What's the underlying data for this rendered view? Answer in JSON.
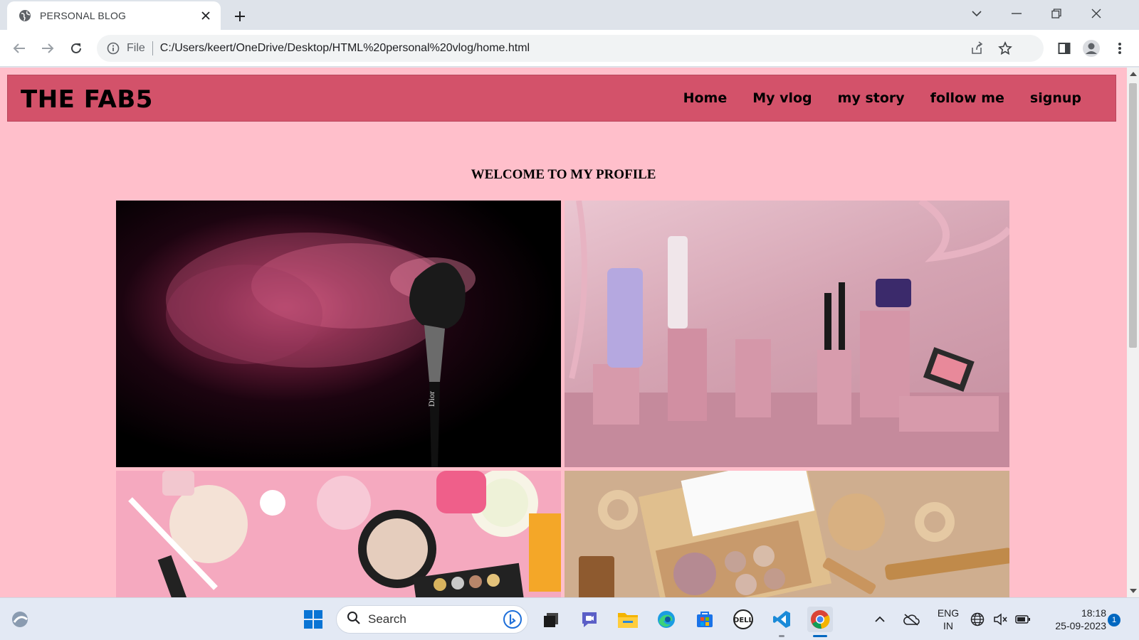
{
  "browser": {
    "tab_title": "PERSONAL BLOG",
    "address_scheme": "File",
    "address_url": "C:/Users/keert/OneDrive/Desktop/HTML%20personal%20vlog/home.html"
  },
  "page": {
    "brand": "THE FAB5",
    "nav": [
      "Home",
      "My vlog",
      "my story",
      "follow me",
      "signup"
    ],
    "welcome": "WELCOME TO MY PROFILE",
    "images": [
      {
        "subject": "makeup brush with pink powder burst",
        "icon": "image-brush"
      },
      {
        "subject": "pink cosmetics products arrangement",
        "icon": "image-products"
      },
      {
        "subject": "pink makeup flatlay",
        "icon": "image-flatlay"
      },
      {
        "subject": "wooden eyeshadow palette flatlay",
        "icon": "image-palette"
      }
    ]
  },
  "taskbar": {
    "search_placeholder": "Search",
    "lang_line1": "ENG",
    "lang_line2": "IN",
    "time": "18:18",
    "date": "25-09-2023",
    "notification_count": "1"
  },
  "colors": {
    "page_bg": "#ffbfcb",
    "header_bg": "#d3526a",
    "accent": "#0067c0"
  }
}
